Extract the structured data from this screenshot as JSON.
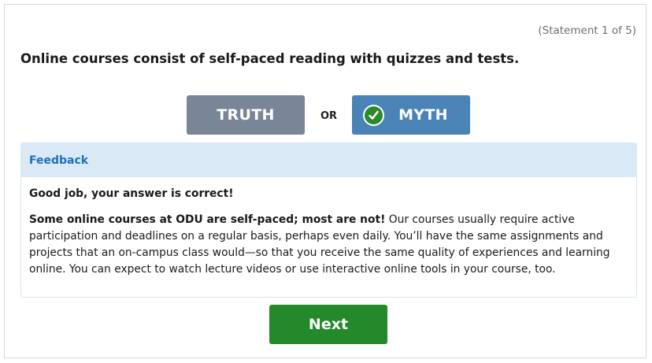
{
  "quiz": {
    "counter": "(Statement 1 of 5)",
    "statement": "Online courses consist of self-paced reading with quizzes and tests.",
    "truth_label": "TRUTH",
    "or_label": "OR",
    "myth_label": "MYTH",
    "selected_answer": "MYTH",
    "selected_icon": "check-circle-icon"
  },
  "feedback": {
    "header": "Feedback",
    "verdict": "Good job, your answer is correct!",
    "lead_bold": "Some online courses at ODU are self-paced; most are not!",
    "body": " Our courses usually require active participation and deadlines on a regular basis, perhaps even daily. You’ll have the same assignments and projects that an on-campus class would—so that you receive the same quality of experiences and learning online. You can expect to watch lecture videos or use interactive online tools in your course, too."
  },
  "actions": {
    "next_label": "Next"
  },
  "colors": {
    "truth_button": "#788697",
    "myth_button": "#4a83b5",
    "check_circle": "#2b8a2b",
    "feedback_header_bg": "#d9eaf6",
    "feedback_header_text": "#1f6fb5",
    "next_button": "#24892a"
  }
}
